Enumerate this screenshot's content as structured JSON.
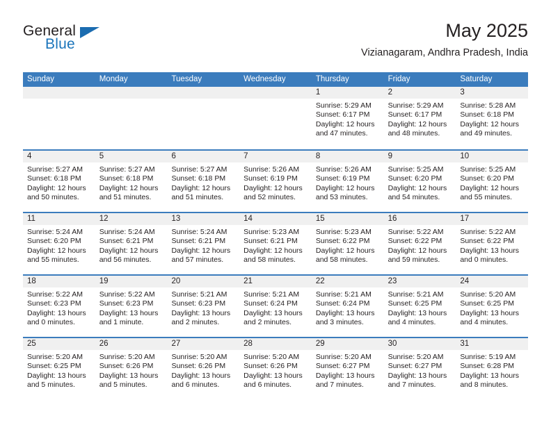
{
  "brand": {
    "name_top": "General",
    "name_bottom": "Blue",
    "accent_color": "#1b6cb0"
  },
  "header": {
    "title": "May 2025",
    "subtitle": "Vizianagaram, Andhra Pradesh, India"
  },
  "calendar": {
    "header_bg": "#3b7cbd",
    "datenum_bg": "#f0f0f0",
    "weekdays": [
      "Sunday",
      "Monday",
      "Tuesday",
      "Wednesday",
      "Thursday",
      "Friday",
      "Saturday"
    ],
    "weeks": [
      [
        {
          "day": "",
          "lines": []
        },
        {
          "day": "",
          "lines": []
        },
        {
          "day": "",
          "lines": []
        },
        {
          "day": "",
          "lines": []
        },
        {
          "day": "1",
          "lines": [
            "Sunrise: 5:29 AM",
            "Sunset: 6:17 PM",
            "Daylight: 12 hours",
            "and 47 minutes."
          ]
        },
        {
          "day": "2",
          "lines": [
            "Sunrise: 5:29 AM",
            "Sunset: 6:17 PM",
            "Daylight: 12 hours",
            "and 48 minutes."
          ]
        },
        {
          "day": "3",
          "lines": [
            "Sunrise: 5:28 AM",
            "Sunset: 6:18 PM",
            "Daylight: 12 hours",
            "and 49 minutes."
          ]
        }
      ],
      [
        {
          "day": "4",
          "lines": [
            "Sunrise: 5:27 AM",
            "Sunset: 6:18 PM",
            "Daylight: 12 hours",
            "and 50 minutes."
          ]
        },
        {
          "day": "5",
          "lines": [
            "Sunrise: 5:27 AM",
            "Sunset: 6:18 PM",
            "Daylight: 12 hours",
            "and 51 minutes."
          ]
        },
        {
          "day": "6",
          "lines": [
            "Sunrise: 5:27 AM",
            "Sunset: 6:18 PM",
            "Daylight: 12 hours",
            "and 51 minutes."
          ]
        },
        {
          "day": "7",
          "lines": [
            "Sunrise: 5:26 AM",
            "Sunset: 6:19 PM",
            "Daylight: 12 hours",
            "and 52 minutes."
          ]
        },
        {
          "day": "8",
          "lines": [
            "Sunrise: 5:26 AM",
            "Sunset: 6:19 PM",
            "Daylight: 12 hours",
            "and 53 minutes."
          ]
        },
        {
          "day": "9",
          "lines": [
            "Sunrise: 5:25 AM",
            "Sunset: 6:20 PM",
            "Daylight: 12 hours",
            "and 54 minutes."
          ]
        },
        {
          "day": "10",
          "lines": [
            "Sunrise: 5:25 AM",
            "Sunset: 6:20 PM",
            "Daylight: 12 hours",
            "and 55 minutes."
          ]
        }
      ],
      [
        {
          "day": "11",
          "lines": [
            "Sunrise: 5:24 AM",
            "Sunset: 6:20 PM",
            "Daylight: 12 hours",
            "and 55 minutes."
          ]
        },
        {
          "day": "12",
          "lines": [
            "Sunrise: 5:24 AM",
            "Sunset: 6:21 PM",
            "Daylight: 12 hours",
            "and 56 minutes."
          ]
        },
        {
          "day": "13",
          "lines": [
            "Sunrise: 5:24 AM",
            "Sunset: 6:21 PM",
            "Daylight: 12 hours",
            "and 57 minutes."
          ]
        },
        {
          "day": "14",
          "lines": [
            "Sunrise: 5:23 AM",
            "Sunset: 6:21 PM",
            "Daylight: 12 hours",
            "and 58 minutes."
          ]
        },
        {
          "day": "15",
          "lines": [
            "Sunrise: 5:23 AM",
            "Sunset: 6:22 PM",
            "Daylight: 12 hours",
            "and 58 minutes."
          ]
        },
        {
          "day": "16",
          "lines": [
            "Sunrise: 5:22 AM",
            "Sunset: 6:22 PM",
            "Daylight: 12 hours",
            "and 59 minutes."
          ]
        },
        {
          "day": "17",
          "lines": [
            "Sunrise: 5:22 AM",
            "Sunset: 6:22 PM",
            "Daylight: 13 hours",
            "and 0 minutes."
          ]
        }
      ],
      [
        {
          "day": "18",
          "lines": [
            "Sunrise: 5:22 AM",
            "Sunset: 6:23 PM",
            "Daylight: 13 hours",
            "and 0 minutes."
          ]
        },
        {
          "day": "19",
          "lines": [
            "Sunrise: 5:22 AM",
            "Sunset: 6:23 PM",
            "Daylight: 13 hours",
            "and 1 minute."
          ]
        },
        {
          "day": "20",
          "lines": [
            "Sunrise: 5:21 AM",
            "Sunset: 6:23 PM",
            "Daylight: 13 hours",
            "and 2 minutes."
          ]
        },
        {
          "day": "21",
          "lines": [
            "Sunrise: 5:21 AM",
            "Sunset: 6:24 PM",
            "Daylight: 13 hours",
            "and 2 minutes."
          ]
        },
        {
          "day": "22",
          "lines": [
            "Sunrise: 5:21 AM",
            "Sunset: 6:24 PM",
            "Daylight: 13 hours",
            "and 3 minutes."
          ]
        },
        {
          "day": "23",
          "lines": [
            "Sunrise: 5:21 AM",
            "Sunset: 6:25 PM",
            "Daylight: 13 hours",
            "and 4 minutes."
          ]
        },
        {
          "day": "24",
          "lines": [
            "Sunrise: 5:20 AM",
            "Sunset: 6:25 PM",
            "Daylight: 13 hours",
            "and 4 minutes."
          ]
        }
      ],
      [
        {
          "day": "25",
          "lines": [
            "Sunrise: 5:20 AM",
            "Sunset: 6:25 PM",
            "Daylight: 13 hours",
            "and 5 minutes."
          ]
        },
        {
          "day": "26",
          "lines": [
            "Sunrise: 5:20 AM",
            "Sunset: 6:26 PM",
            "Daylight: 13 hours",
            "and 5 minutes."
          ]
        },
        {
          "day": "27",
          "lines": [
            "Sunrise: 5:20 AM",
            "Sunset: 6:26 PM",
            "Daylight: 13 hours",
            "and 6 minutes."
          ]
        },
        {
          "day": "28",
          "lines": [
            "Sunrise: 5:20 AM",
            "Sunset: 6:26 PM",
            "Daylight: 13 hours",
            "and 6 minutes."
          ]
        },
        {
          "day": "29",
          "lines": [
            "Sunrise: 5:20 AM",
            "Sunset: 6:27 PM",
            "Daylight: 13 hours",
            "and 7 minutes."
          ]
        },
        {
          "day": "30",
          "lines": [
            "Sunrise: 5:20 AM",
            "Sunset: 6:27 PM",
            "Daylight: 13 hours",
            "and 7 minutes."
          ]
        },
        {
          "day": "31",
          "lines": [
            "Sunrise: 5:19 AM",
            "Sunset: 6:28 PM",
            "Daylight: 13 hours",
            "and 8 minutes."
          ]
        }
      ]
    ]
  }
}
